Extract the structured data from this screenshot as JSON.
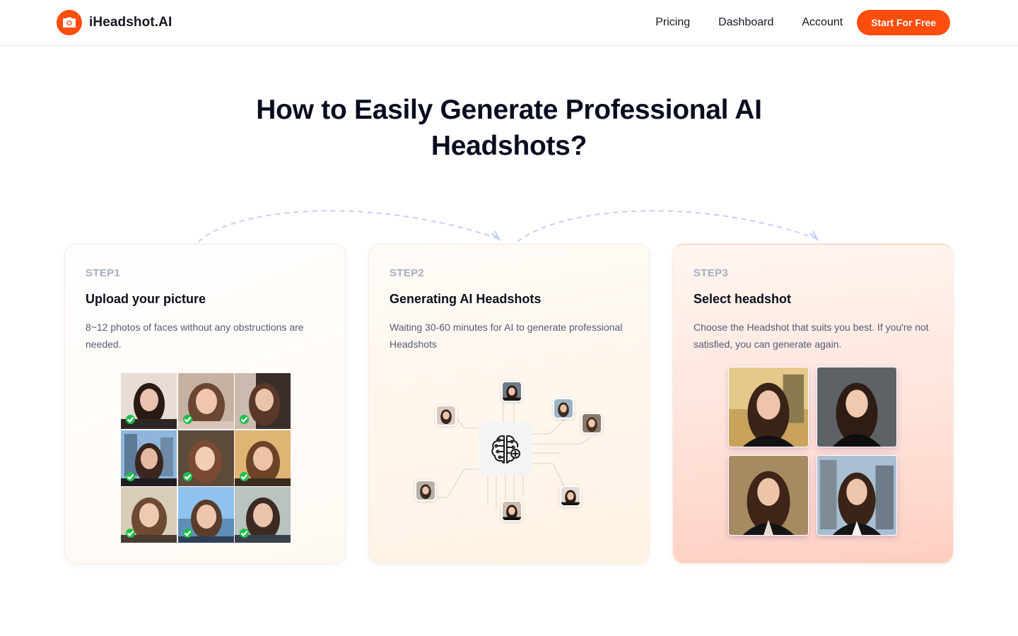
{
  "header": {
    "logo_text": "iHeadshot.AI",
    "nav": [
      "Pricing",
      "Dashboard",
      "Account"
    ],
    "cta_label": "Start For Free"
  },
  "main": {
    "title": "How to Easily Generate Professional AI Headshots?",
    "steps": [
      {
        "step_label": "STEP1",
        "title": "Upload your picture",
        "description": "8~12 photos of faces without any obstructions are needed."
      },
      {
        "step_label": "STEP2",
        "title": "Generating AI Headshots",
        "description": "Waiting 30-60 minutes for AI to generate professional Headshots"
      },
      {
        "step_label": "STEP3",
        "title": "Select headshot",
        "description": "Choose the Headshot that suits you best. If you're not satisfied, you can generate again."
      }
    ]
  },
  "colors": {
    "brand": "#ff4d0d",
    "check": "#1fbf4c",
    "arrow": "#c9d2f5"
  },
  "icons": [
    "camera-icon",
    "check-icon",
    "ai-brain-icon",
    "dashed-arrow-icon"
  ]
}
